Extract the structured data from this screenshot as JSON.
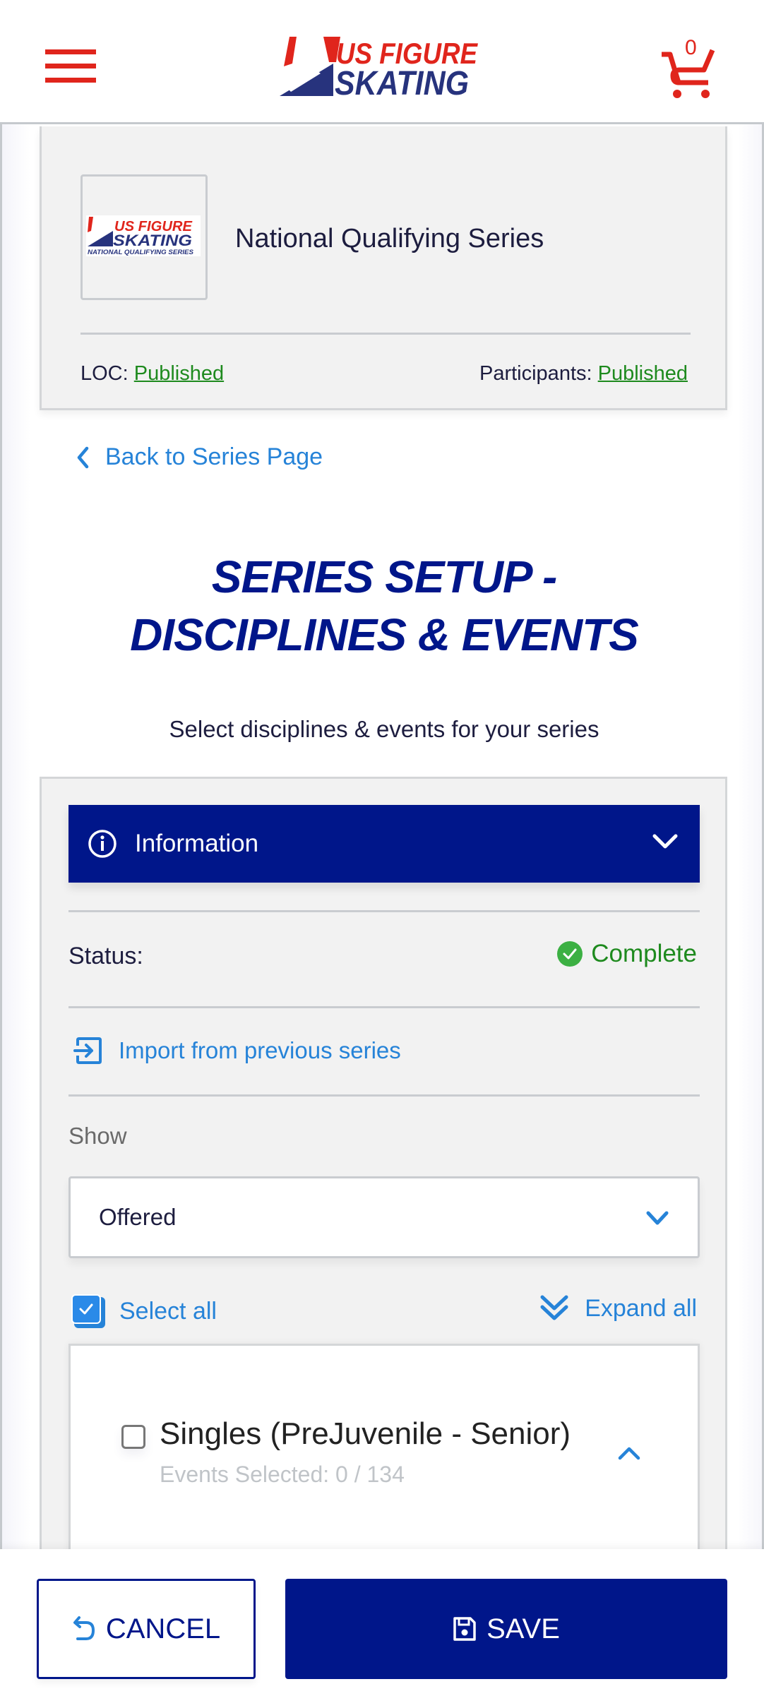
{
  "header": {
    "menu_icon": "hamburger-menu-icon",
    "logo_alt": "US Figure Skating",
    "logo_line1": "US FIGURE",
    "logo_line2": "SKATING",
    "cart_icon": "shopping-cart-icon",
    "cart_count": "0",
    "brand_red": "#e0251c",
    "brand_blue": "#00168a"
  },
  "series": {
    "thumbnail_line1": "US FIGURE",
    "thumbnail_line2": "SKATING",
    "thumbnail_line3": "NATIONAL QUALIFYING SERIES",
    "name": "National Qualifying Series",
    "loc_label": "LOC:",
    "loc_status": "Published",
    "participants_label": "Participants:",
    "participants_status": "Published"
  },
  "nav": {
    "back_label": "Back to Series Page"
  },
  "page": {
    "title_line1": "SERIES SETUP -",
    "title_line2": "DISCIPLINES & EVENTS",
    "subtitle": "Select disciplines & events for your series"
  },
  "panel": {
    "info_label": "Information",
    "status_label": "Status:",
    "status_value": "Complete",
    "import_label": "Import from previous series",
    "show_label": "Show",
    "show_value": "Offered",
    "select_all_label": "Select all",
    "select_all_checked": true,
    "expand_all_label": "Expand all",
    "disciplines": [
      {
        "title": "Singles (PreJuvenile - Senior)",
        "events_selected": "Events Selected: 0 / 134",
        "checked": false
      }
    ]
  },
  "footer": {
    "cancel_label": "CANCEL",
    "save_label": "SAVE"
  }
}
